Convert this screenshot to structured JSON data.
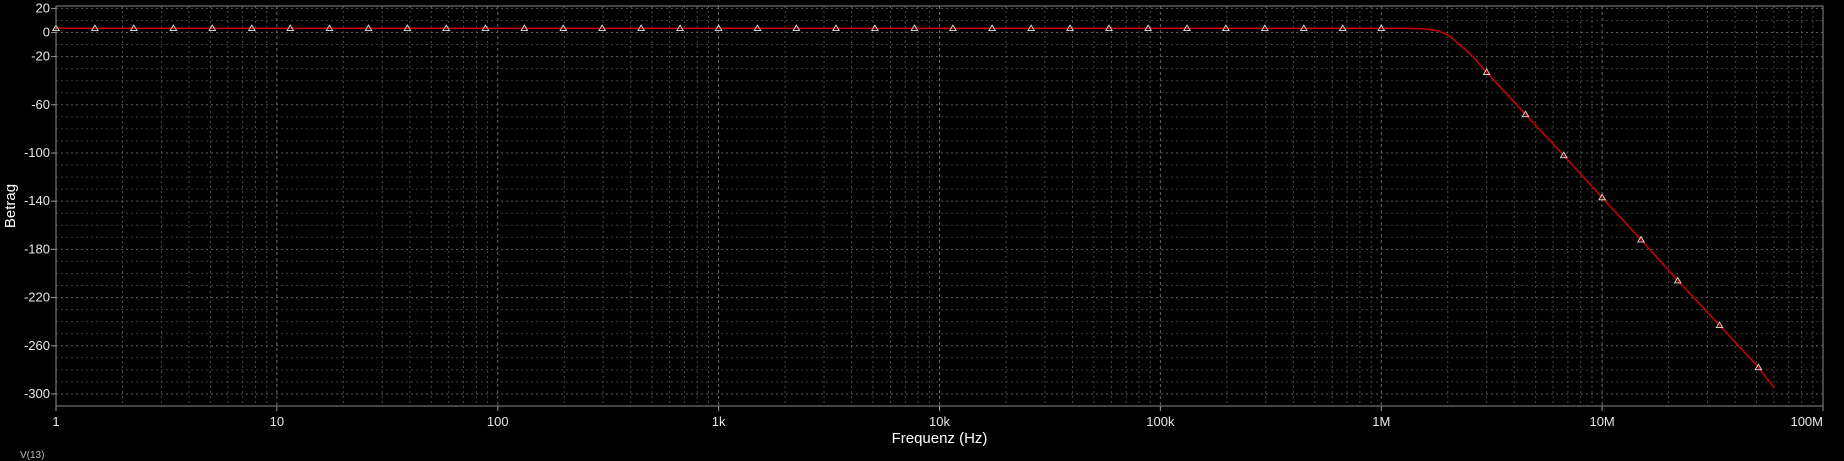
{
  "chart_data": {
    "type": "line",
    "title": "",
    "xlabel": "Frequenz (Hz)",
    "ylabel": "Betrag",
    "x_scale": "log",
    "xlim": [
      1,
      100000000
    ],
    "ylim": [
      -310,
      22
    ],
    "x_ticks": [
      {
        "value": 1,
        "label": "1"
      },
      {
        "value": 10,
        "label": "10"
      },
      {
        "value": 100,
        "label": "100"
      },
      {
        "value": 1000,
        "label": "1k"
      },
      {
        "value": 10000,
        "label": "10k"
      },
      {
        "value": 100000,
        "label": "100k"
      },
      {
        "value": 1000000,
        "label": "1M"
      },
      {
        "value": 10000000,
        "label": "10M"
      },
      {
        "value": 100000000,
        "label": "100M"
      }
    ],
    "y_ticks": [
      {
        "value": 20,
        "label": "20"
      },
      {
        "value": 0,
        "label": "0"
      },
      {
        "value": -20,
        "label": "-20"
      },
      {
        "value": -60,
        "label": "-60"
      },
      {
        "value": -100,
        "label": "-100"
      },
      {
        "value": -140,
        "label": "-140"
      },
      {
        "value": -180,
        "label": "-180"
      },
      {
        "value": -220,
        "label": "-220"
      },
      {
        "value": -260,
        "label": "-260"
      },
      {
        "value": -300,
        "label": "-300"
      }
    ],
    "grid": true,
    "series": [
      {
        "name": "V(13)",
        "color": "#c00000",
        "marker": "triangle",
        "marker_color": "#e0e0e0",
        "x": [
          1,
          1.5,
          2.25,
          3.4,
          5.1,
          7.7,
          11.5,
          17.3,
          26,
          39,
          58.5,
          88,
          132,
          198,
          297,
          446,
          669,
          1000,
          1500,
          2250,
          3400,
          5100,
          7700,
          11500,
          17300,
          26000,
          39000,
          58500,
          88000,
          132000,
          198000,
          297000,
          446000,
          669000,
          1000000,
          1300000,
          1600000,
          1800000,
          2000000,
          2200000,
          2600000,
          3000000,
          4500000,
          6700000,
          10000000,
          15000000,
          22000000,
          34000000,
          51000000,
          60000000
        ],
        "y": [
          3.5,
          3.5,
          3.5,
          3.5,
          3.5,
          3.5,
          3.5,
          3.5,
          3.5,
          3.5,
          3.5,
          3.5,
          3.5,
          3.5,
          3.5,
          3.5,
          3.5,
          3.5,
          3.5,
          3.5,
          3.5,
          3.5,
          3.5,
          3.5,
          3.5,
          3.5,
          3.5,
          3.5,
          3.5,
          3.5,
          3.5,
          3.5,
          3.5,
          3.5,
          3.5,
          3.5,
          3.0,
          1.5,
          -2,
          -8,
          -20,
          -33,
          -68,
          -102,
          -137,
          -172,
          -206,
          -243,
          -278,
          -295
        ]
      }
    ],
    "legend": "bottom-left",
    "annotations": []
  }
}
